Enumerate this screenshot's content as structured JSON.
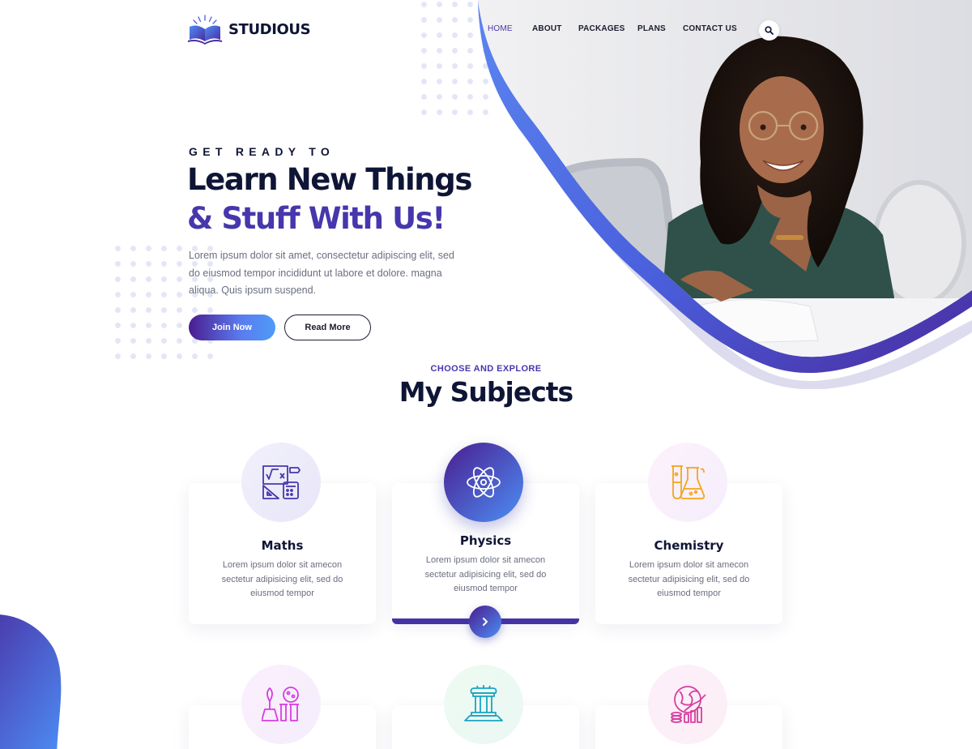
{
  "brand": {
    "name": "STUDIOUS"
  },
  "nav": {
    "items": [
      "HOME",
      "ABOUT",
      "PACKAGES",
      "PLANS",
      "CONTACT US"
    ],
    "active": "HOME"
  },
  "hero": {
    "eyebrow": "GET READY TO",
    "headline_line1": "Learn New Things",
    "headline_line2": "& Stuff With Us!",
    "description": "Lorem ipsum dolor sit amet, consectetur  adipiscing elit, sed do eiusmod tempor  incididunt ut labore et dolore. magna aliqua. Quis ipsum suspend.",
    "join_label": "Join Now",
    "read_label": "Read More"
  },
  "subjects": {
    "eyebrow": "CHOOSE AND EXPLORE",
    "title": "My Subjects",
    "cards": [
      {
        "title": "Maths",
        "description": "Lorem ipsum dolor sit amecon sectetur adipisicing elit, sed do eiusmod tempor",
        "icon": "math-board-icon"
      },
      {
        "title": "Physics",
        "description": "Lorem ipsum dolor sit amecon sectetur adipisicing elit, sed do eiusmod tempor",
        "icon": "atom-icon"
      },
      {
        "title": "Chemistry",
        "description": "Lorem ipsum dolor sit amecon sectetur adipisicing elit, sed do eiusmod tempor",
        "icon": "flask-icon"
      }
    ],
    "lower_card_icons": [
      "plant-lab-icon",
      "history-column-icon",
      "globe-economy-icon"
    ]
  },
  "colors": {
    "primary": "#4637ac",
    "dark": "#0f1535",
    "gradient_start": "#4a1d8f",
    "gradient_end": "#4d9cf6"
  }
}
